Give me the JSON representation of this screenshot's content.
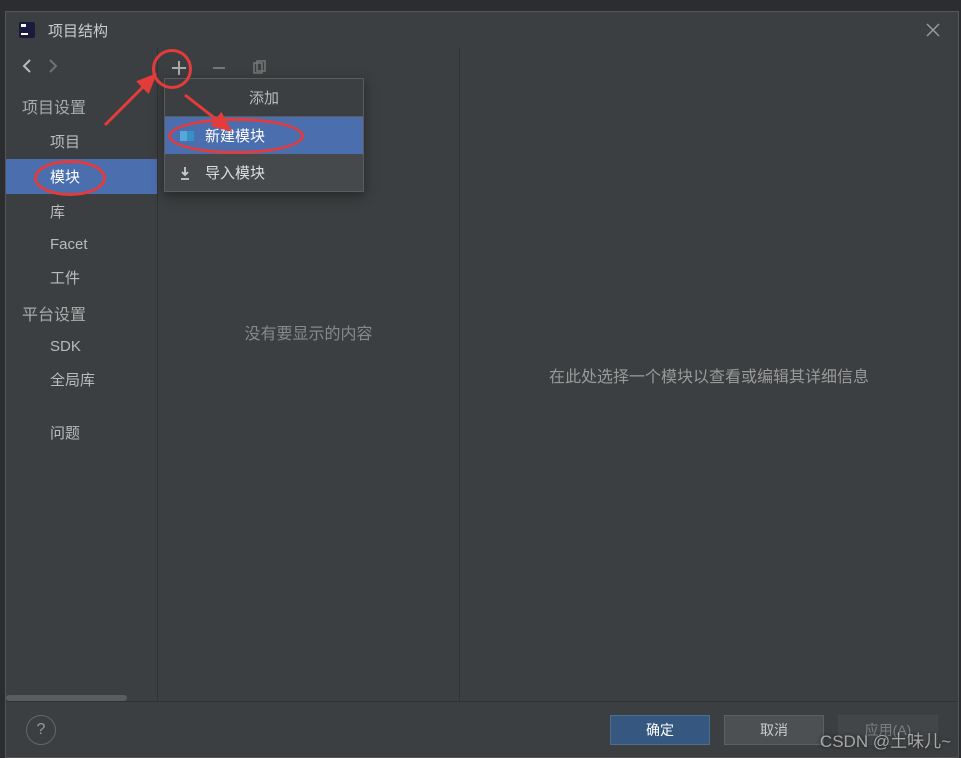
{
  "title": "项目结构",
  "sidebar": {
    "section1": "项目设置",
    "items1": [
      "项目",
      "模块",
      "库",
      "Facet",
      "工件"
    ],
    "section2": "平台设置",
    "items2": [
      "SDK",
      "全局库"
    ],
    "section3_item": "问题"
  },
  "popup": {
    "header": "添加",
    "new_module": "新建模块",
    "import_module": "导入模块"
  },
  "mid": {
    "empty": "没有要显示的内容"
  },
  "main": {
    "placeholder": "在此处选择一个模块以查看或编辑其详细信息"
  },
  "footer": {
    "ok": "确定",
    "cancel": "取消",
    "apply": "应用(A)"
  },
  "watermark": "CSDN @土味儿~"
}
